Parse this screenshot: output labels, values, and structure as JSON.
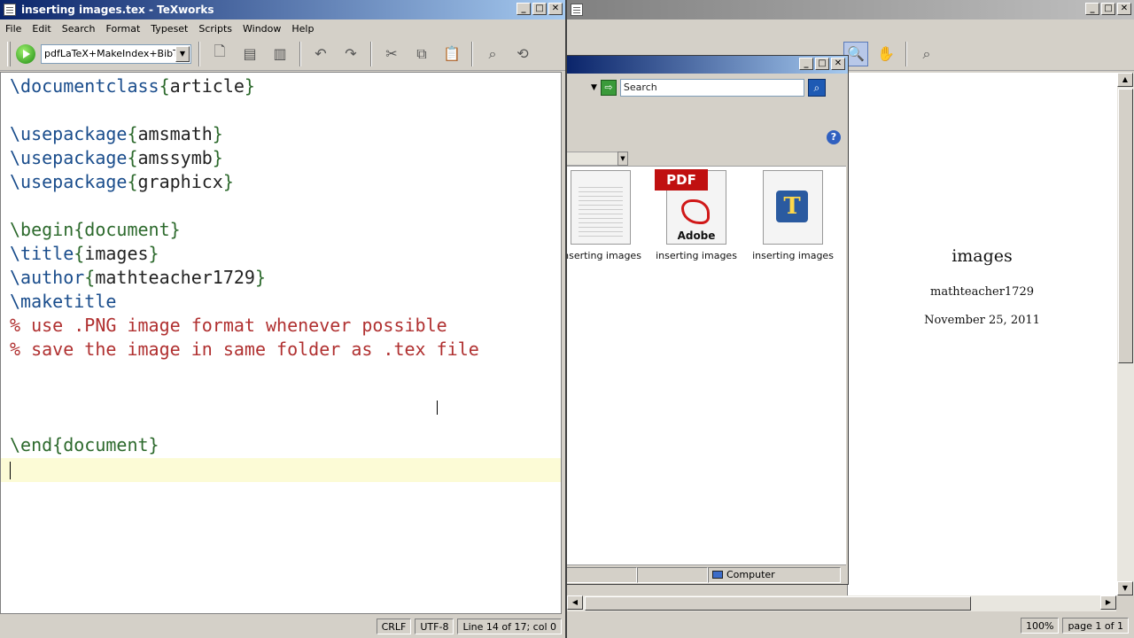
{
  "editor": {
    "title": "inserting images.tex - TeXworks",
    "menu": [
      "File",
      "Edit",
      "Search",
      "Format",
      "Typeset",
      "Scripts",
      "Window",
      "Help"
    ],
    "engine": "pdfLaTeX+MakeIndex+BibTeX",
    "code": [
      {
        "cmd": "\\documentclass",
        "open": "{",
        "arg": "article",
        "close": "}"
      },
      {
        "cmd": "\\usepackage",
        "open": "{",
        "arg": "amsmath",
        "close": "}"
      },
      {
        "cmd": "\\usepackage",
        "open": "{",
        "arg": "amssymb",
        "close": "}"
      },
      {
        "cmd": "\\usepackage",
        "open": "{",
        "arg": "graphicx",
        "close": "}"
      },
      {
        "cmd": "\\begin",
        "open": "{",
        "arg": "document",
        "close": "}"
      },
      {
        "cmd": "\\title",
        "open": "{",
        "arg": "images",
        "close": "}"
      },
      {
        "cmd": "\\author",
        "open": "{",
        "arg": "mathteacher1729",
        "close": "}"
      },
      {
        "cmd": "\\maketitle"
      },
      {
        "comment": "% use .PNG image format whenever possible"
      },
      {
        "comment": "% save the image in same folder as .tex file"
      },
      {
        "cmd": "\\end",
        "open": "{",
        "arg": "document",
        "close": "}"
      }
    ],
    "status": {
      "line_ending": "CRLF",
      "encoding": "UTF-8",
      "position": "Line 14 of 17; col 0"
    }
  },
  "explorer": {
    "search_placeholder": "Search",
    "files": [
      {
        "label": "inserting images",
        "type": "text-file-icon"
      },
      {
        "label": "inserting images",
        "type": "pdf-file-icon",
        "badge": "PDF",
        "brand": "Adobe"
      },
      {
        "label": "inserting images",
        "type": "tex-file-icon",
        "glyph": "T"
      }
    ],
    "status_location": "Computer"
  },
  "preview": {
    "doc_title": "images",
    "doc_author": "mathteacher1729",
    "doc_date": "November 25, 2011",
    "zoom": "100%",
    "page": "page 1 of 1"
  },
  "colors": {
    "keyword": "#1a4d8c",
    "brace": "#2d6a2d",
    "comment": "#b03030",
    "current_line": "#fcfbd6"
  }
}
